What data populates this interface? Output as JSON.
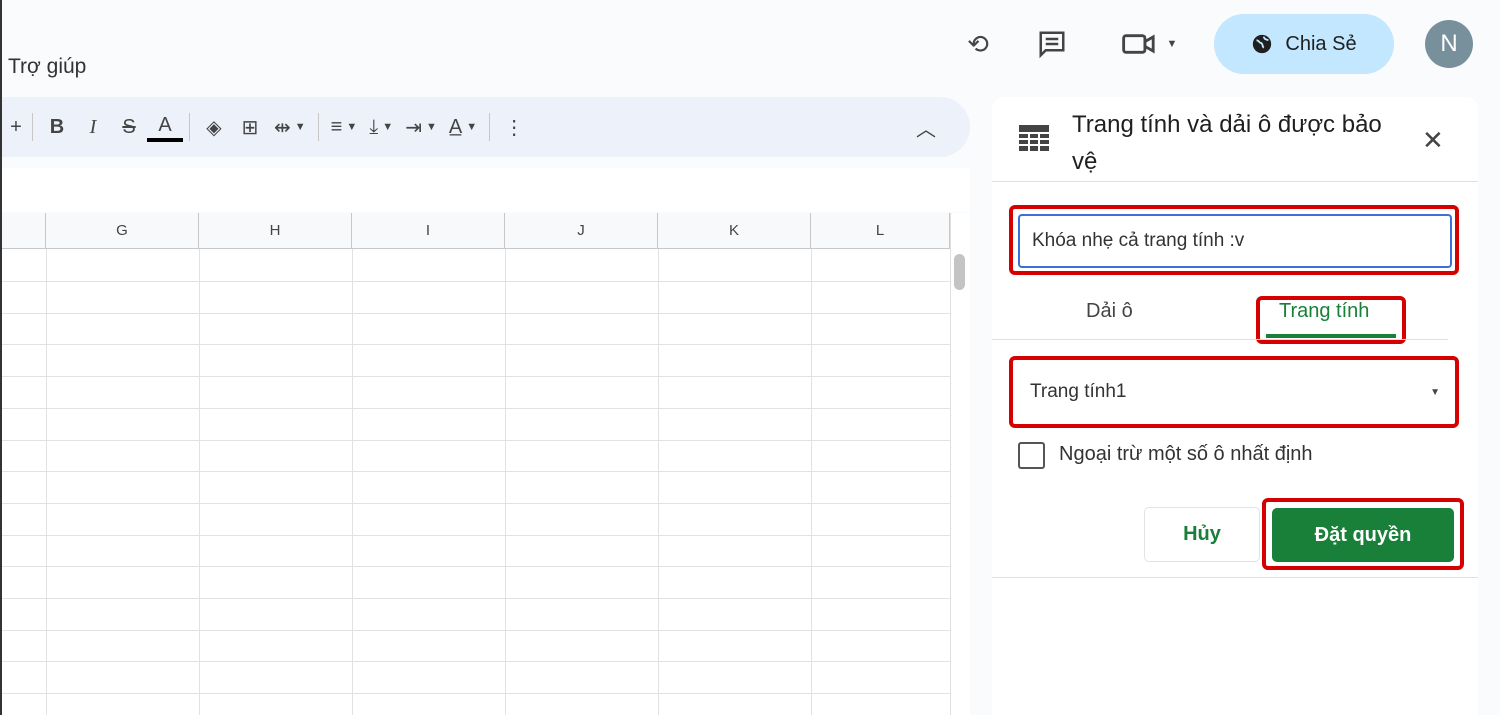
{
  "menu": {
    "help": "Trợ giúp"
  },
  "header": {
    "share_label": "Chia Sẻ",
    "avatar_initial": "N"
  },
  "toolbar": {
    "bold": "B",
    "italic": "I",
    "text_color": "A",
    "plus": "+"
  },
  "columns": [
    "G",
    "H",
    "I",
    "J",
    "K",
    "L"
  ],
  "panel": {
    "title": "Trang tính và dải ô được bảo vệ",
    "description_value": "Khóa nhẹ cả trang tính :v",
    "tabs": [
      {
        "label": "Dải ô",
        "active": false
      },
      {
        "label": "Trang tính",
        "active": true
      }
    ],
    "sheet_select": "Trang tính1",
    "except_label": "Ngoại trừ một số ô nhất định",
    "except_checked": false,
    "cancel": "Hủy",
    "submit": "Đặt quyền"
  },
  "colors": {
    "accent_green": "#188038",
    "highlight_red": "#d50000",
    "share_bg": "#c2e7ff"
  }
}
